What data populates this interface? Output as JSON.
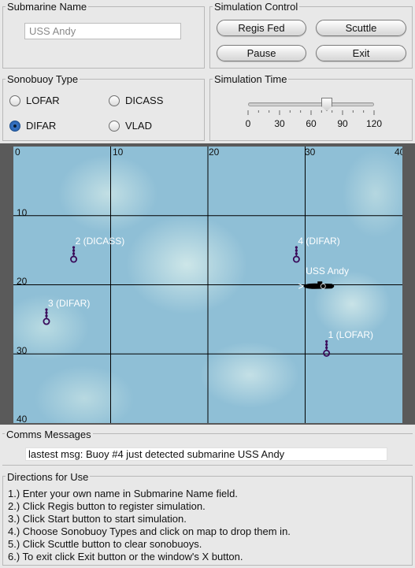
{
  "submarine_name": {
    "title": "Submarine Name",
    "value": "USS Andy"
  },
  "simulation_control": {
    "title": "Simulation Control",
    "buttons": [
      "Regis Fed",
      "Scuttle",
      "Pause",
      "Exit"
    ]
  },
  "sonobuoy_type": {
    "title": "Sonobuoy Type",
    "options": [
      {
        "label": "LOFAR",
        "selected": false
      },
      {
        "label": "DICASS",
        "selected": false
      },
      {
        "label": "DIFAR",
        "selected": true
      },
      {
        "label": "VLAD",
        "selected": false
      }
    ]
  },
  "simulation_time": {
    "title": "Simulation Time",
    "ticks": [
      "0",
      "30",
      "60",
      "90",
      "120"
    ],
    "min": 0,
    "max": 120,
    "value": 75
  },
  "map": {
    "x_labels": [
      "0",
      "10",
      "20",
      "30",
      "40"
    ],
    "y_labels": [
      "10",
      "20",
      "30",
      "40"
    ],
    "buoys": [
      {
        "label": "2 (DICASS)",
        "x": 6.2,
        "y": 16.3
      },
      {
        "label": "4 (DIFAR)",
        "x": 29.1,
        "y": 16.3
      },
      {
        "label": "3 (DIFAR)",
        "x": 3.4,
        "y": 25.3
      },
      {
        "label": "1 (LOFAR)",
        "x": 32.2,
        "y": 29.9
      }
    ],
    "submarine": {
      "label": "USS Andy",
      "x": 31.6,
      "y": 20.2
    }
  },
  "comms": {
    "title": "Comms Messages",
    "message": "lastest msg: Buoy #4 just detected submarine USS Andy"
  },
  "directions": {
    "title": "Directions for Use",
    "lines": [
      "1.) Enter your own name in Submarine Name field.",
      "2.) Click Regis button to register simulation.",
      "3.) Click Start button to start simulation.",
      "4.) Choose Sonobuoy Types and click on map to drop them in.",
      "5.) Click Scuttle button to clear sonobuoys.",
      "6.) To exit click Exit button or the window's X button."
    ]
  }
}
